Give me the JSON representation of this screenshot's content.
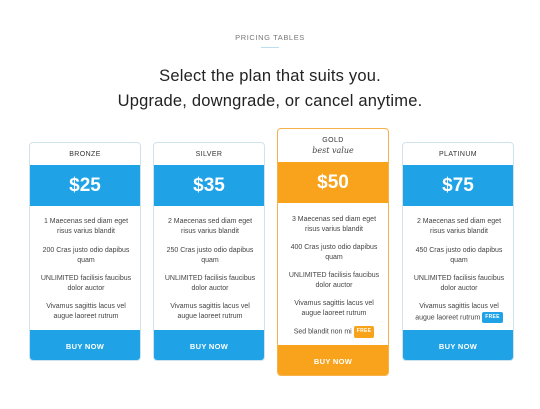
{
  "header": {
    "eyebrow": "PRICING TABLES",
    "headline_line1": "Select the plan that suits you.",
    "headline_line2": "Upgrade, downgrade, or cancel anytime."
  },
  "colors": {
    "accent_blue": "#1fa3e6",
    "accent_orange": "#f8a31b"
  },
  "plans": [
    {
      "name": "BRONZE",
      "price": "$25",
      "features": [
        "1 Maecenas sed diam eget risus varius blandit",
        "200 Cras justo odio dapibus quam",
        "UNLIMITED facilisis faucibus dolor auctor",
        "Vivamus sagittis lacus vel augue laoreet rutrum"
      ],
      "cta": "BUY NOW"
    },
    {
      "name": "SILVER",
      "price": "$35",
      "features": [
        "2 Maecenas sed diam eget risus varius blandit",
        "250 Cras justo odio dapibus quam",
        "UNLIMITED facilisis faucibus dolor auctor",
        "Vivamus sagittis lacus vel augue laoreet rutrum"
      ],
      "cta": "BUY NOW"
    },
    {
      "name": "GOLD",
      "tagline": "best value",
      "price": "$50",
      "features": [
        "3 Maecenas sed diam eget risus varius blandit",
        "400 Cras justo odio dapibus quam",
        "UNLIMITED facilisis faucibus dolor auctor",
        "Vivamus sagittis lacus vel augue laoreet rutrum",
        "Sed blandit non mi"
      ],
      "badge": "FREE",
      "cta": "BUY NOW"
    },
    {
      "name": "PLATINUM",
      "price": "$75",
      "features": [
        "2 Maecenas sed diam eget risus varius blandit",
        "450 Cras justo odio dapibus quam",
        "UNLIMITED facilisis faucibus dolor auctor",
        "Vivamus sagittis lacus vel augue laoreet rutrum"
      ],
      "badge": "FREE",
      "cta": "BUY NOW"
    }
  ]
}
